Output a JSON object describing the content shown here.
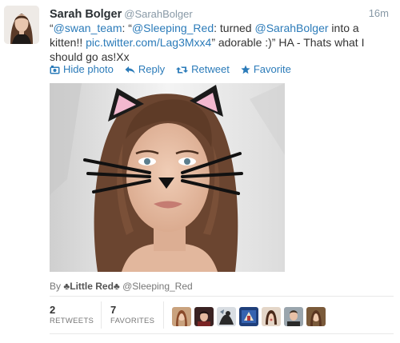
{
  "tweet": {
    "fullname": "Sarah Bolger",
    "username": "@SarahBolger",
    "timestamp": "16m",
    "text": {
      "open_quote": "“",
      "mention_swan": "@swan_team",
      "colon_quote": ": “",
      "mention_sleeping": "@Sleeping_Red",
      "middle": ": turned ",
      "mention_sarah": "@SarahBolger",
      "after": " into a kitten!! ",
      "link": "pic.twitter.com/Lag3Mxx4",
      "tail": "” adorable :)” HA - Thats what I should go as!Xx"
    },
    "actions": {
      "hide_photo": "Hide photo",
      "reply": "Reply",
      "retweet": "Retweet",
      "favorite": "Favorite"
    },
    "photo_byline": {
      "prefix": "By",
      "name": "♣Little Red♣",
      "handle": "@Sleeping_Red"
    },
    "stats": {
      "retweets_count": "2",
      "retweets_label": "RETWEETS",
      "favorites_count": "7",
      "favorites_label": "FAVORITES"
    }
  },
  "colors": {
    "link": "#2b7bb9",
    "muted": "#8899a6",
    "text": "#333333"
  },
  "icons": {
    "hide_photo": "photo-icon",
    "reply": "reply-arrow-icon",
    "retweet": "retweet-icon",
    "favorite": "star-icon"
  }
}
